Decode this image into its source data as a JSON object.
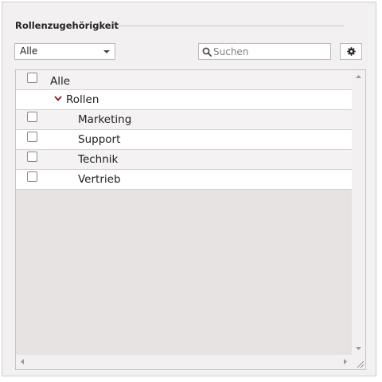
{
  "panel": {
    "title": "Rollenzugehörigkeit"
  },
  "filter": {
    "selected": "Alle"
  },
  "search": {
    "placeholder": "Suchen",
    "value": ""
  },
  "settings": {
    "icon": "gear-icon"
  },
  "tree": {
    "header": {
      "label": "Alle",
      "checked": false
    },
    "group": {
      "label": "Rollen",
      "expanded": true
    },
    "items": [
      {
        "label": "Marketing",
        "checked": false
      },
      {
        "label": "Support",
        "checked": false
      },
      {
        "label": "Technik",
        "checked": false
      },
      {
        "label": "Vertrieb",
        "checked": false
      }
    ]
  },
  "colors": {
    "chevron": "#8b1a1a",
    "panel_bg": "#f2f0f0",
    "tree_empty_bg": "#e6e3e2"
  }
}
